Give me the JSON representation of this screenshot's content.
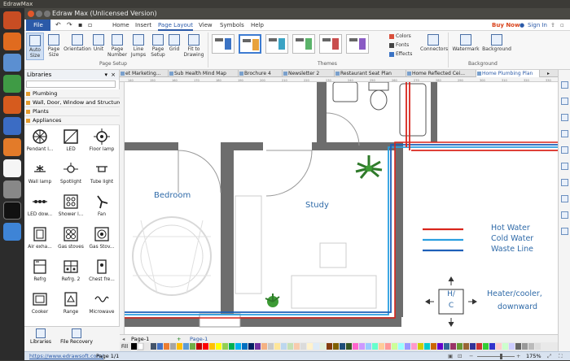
{
  "os": {
    "app_name": "EdrawMax"
  },
  "window": {
    "title": "Edraw Max (Unlicensed Version)"
  },
  "menu": {
    "file": "File",
    "home": "Home",
    "insert": "Insert",
    "page_layout": "Page Layout",
    "view": "View",
    "symbols": "Symbols",
    "help": "Help",
    "buy_now": "Buy Now",
    "sign_in": "Sign In"
  },
  "ribbon": {
    "auto_size": "Auto Size",
    "page_size": "Page Size",
    "orientation": "Orientation",
    "unit": "Unit",
    "page_number": "Page Number",
    "line_jumps": "Line Jumps",
    "page_setup": "Page Setup",
    "grid": "Grid",
    "fit_to_drawing": "Fit to Drawing",
    "group_page_setup": "Page Setup",
    "colors": "Colors",
    "fonts": "Fonts",
    "effects": "Effects",
    "connectors": "Connectors",
    "group_themes": "Themes",
    "watermark": "Watermark",
    "background": "Background",
    "group_background": "Background"
  },
  "libraries": {
    "title": "Libraries",
    "categories": [
      "Plumbing",
      "Wall, Door, Window and Structure",
      "Plants",
      "Appliances"
    ],
    "items": [
      "Pendant l...",
      "LED",
      "Floor lamp",
      "Wall lamp",
      "Spotlight",
      "Tube light",
      "LED dow...",
      "Shower l...",
      "Fan",
      "Air exha...",
      "Gas stoves",
      "Gas Stov...",
      "Refrg",
      "Refrg. 2",
      "Chest fre...",
      "Cooker",
      "Range",
      "Microwave"
    ],
    "bottom": [
      "Libraries",
      "File Recovery"
    ]
  },
  "doc_tabs": [
    "et Marketing...",
    "Sub Health Mind Map",
    "Brochure 4",
    "Newsletter 2",
    "Restaurant Seat Plan",
    "Home Reflected Cei...",
    "Home Plumbing Plan"
  ],
  "ruler_labels": [
    "140",
    "150",
    "160",
    "170",
    "180",
    "190",
    "200",
    "210",
    "220",
    "230",
    "240",
    "250",
    "260",
    "270",
    "280",
    "290",
    "300",
    "310",
    "320",
    "330"
  ],
  "canvas": {
    "bedroom": "Bedroom",
    "study": "Study",
    "legend": [
      "Hot Water",
      "Cold Water",
      "Waste Line"
    ],
    "heater_top": "H/",
    "heater_bottom": "C",
    "heater_label_1": "Heater/cooler,",
    "heater_label_2": "downward"
  },
  "colors": {
    "hot": "#d9251c",
    "cold": "#2a9fe0",
    "waste": "#1d5fb8",
    "label": "#2f6aa8"
  },
  "page_tabs": {
    "current_left": "Page-1",
    "add": "+",
    "current": "Page-1"
  },
  "fill_label": "Fill",
  "status": {
    "url": "https://www.edrawsoft.com/",
    "page": "Page 1/1",
    "zoom": "175%"
  }
}
